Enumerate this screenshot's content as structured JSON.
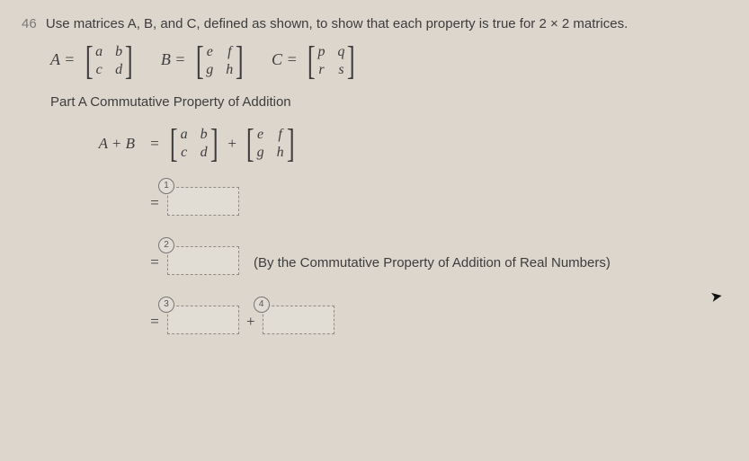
{
  "question_number": "46",
  "prompt": "Use matrices A, B, and C, defined as shown, to show that each property is true for 2 × 2 matrices.",
  "matrices": {
    "A": {
      "label": "A =",
      "cells": [
        "a",
        "b",
        "c",
        "d"
      ]
    },
    "B": {
      "label": "B =",
      "cells": [
        "e",
        "f",
        "g",
        "h"
      ]
    },
    "C": {
      "label": "C =",
      "cells": [
        "p",
        "q",
        "r",
        "s"
      ]
    }
  },
  "partA_label": "Part A  Commutative Property of Addition",
  "step1": {
    "lhs": "A + B",
    "eq": "=",
    "plus": "+",
    "m1": [
      "a",
      "b",
      "c",
      "d"
    ],
    "m2": [
      "e",
      "f",
      "g",
      "h"
    ]
  },
  "eq_sign": "=",
  "plus_sign": "+",
  "blanks": {
    "b1": "1",
    "b2": "2",
    "b3": "3",
    "b4": "4"
  },
  "explain2": "(By the Commutative Property of Addition of Real Numbers)"
}
